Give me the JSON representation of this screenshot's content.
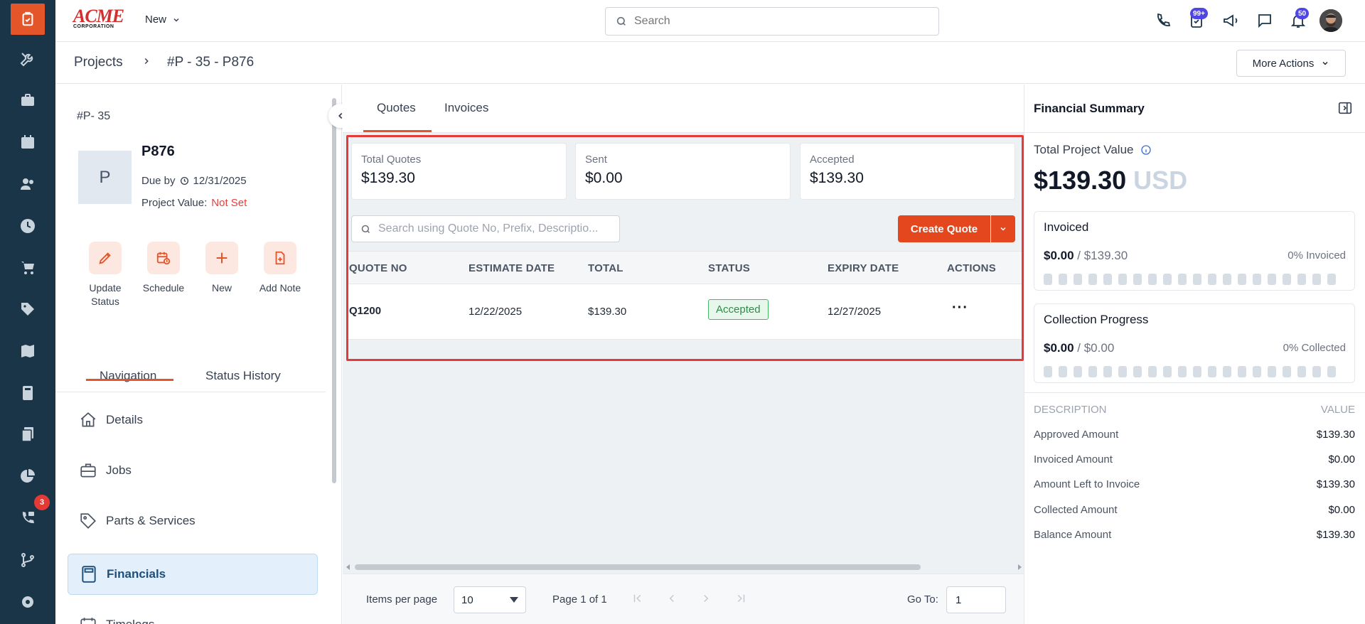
{
  "brand": {
    "logo_main": "ACME",
    "logo_sub": "CORPORATION",
    "accent": "#e4552a"
  },
  "sidebar": {
    "icons": [
      "tools-icon",
      "briefcase-icon",
      "calendar-icon",
      "users-icon",
      "clock-icon",
      "cart-icon",
      "tag-icon",
      "map-icon",
      "calculator-icon",
      "documents-icon",
      "pie-chart-icon",
      "phone-chat-icon",
      "git-branch-icon",
      "gear-icon"
    ],
    "phone_badge": "3"
  },
  "header": {
    "new_label": "New",
    "search_placeholder": "Search",
    "tasks_badge": "99+",
    "notif_badge": "50"
  },
  "breadcrumb": {
    "root": "Projects",
    "current": "#P - 35 - P876"
  },
  "more_actions": "More Actions",
  "project": {
    "id_label": "#P- 35",
    "avatar_letter": "P",
    "name": "P876",
    "due_label": "Due by",
    "due_date": "12/31/2025",
    "value_label": "Project Value:",
    "value": "Not Set"
  },
  "quick_actions": [
    {
      "label": "Update Status"
    },
    {
      "label": "Schedule"
    },
    {
      "label": "New"
    },
    {
      "label": "Add Note"
    }
  ],
  "nav_tabs": {
    "navigation": "Navigation",
    "status_history": "Status History"
  },
  "nav_items": [
    {
      "label": "Details"
    },
    {
      "label": "Jobs"
    },
    {
      "label": "Parts & Services"
    },
    {
      "label": "Financials"
    },
    {
      "label": "Timelogs"
    }
  ],
  "center": {
    "tabs": [
      "Quotes",
      "Invoices"
    ],
    "stats": [
      {
        "label": "Total Quotes",
        "value": "$139.30"
      },
      {
        "label": "Sent",
        "value": "$0.00"
      },
      {
        "label": "Accepted",
        "value": "$139.30"
      }
    ],
    "search_placeholder": "Search using Quote No, Prefix, Descriptio...",
    "create_quote": "Create Quote",
    "columns": [
      "QUOTE NO",
      "ESTIMATE DATE",
      "TOTAL",
      "STATUS",
      "EXPIRY DATE",
      "ACTIONS"
    ],
    "rows": [
      {
        "quote_no": "Q1200",
        "estimate_date": "12/22/2025",
        "total": "$139.30",
        "status": "Accepted",
        "expiry_date": "12/27/2025",
        "actions": "···"
      }
    ],
    "pager": {
      "items_per_page_label": "Items per page",
      "items_per_page": "10",
      "page_info": "Page 1 of 1",
      "goto_label": "Go To:",
      "goto_value": "1"
    }
  },
  "financial_summary": {
    "title": "Financial Summary",
    "total_label": "Total Project Value",
    "total_value": "$139.30",
    "currency": "USD",
    "invoiced": {
      "title": "Invoiced",
      "amount": "$0.00",
      "total": "/ $139.30",
      "pct": "0% Invoiced",
      "progress": 0
    },
    "collection": {
      "title": "Collection Progress",
      "amount": "$0.00",
      "total": "/ $0.00",
      "pct": "0% Collected",
      "progress": 0
    },
    "desc_header": "DESCRIPTION",
    "value_header": "VALUE",
    "rows": [
      {
        "k": "Approved Amount",
        "v": "$139.30"
      },
      {
        "k": "Invoiced Amount",
        "v": "$0.00"
      },
      {
        "k": "Amount Left to Invoice",
        "v": "$139.30"
      },
      {
        "k": "Collected Amount",
        "v": "$0.00"
      },
      {
        "k": "Balance Amount",
        "v": "$139.30"
      }
    ]
  }
}
